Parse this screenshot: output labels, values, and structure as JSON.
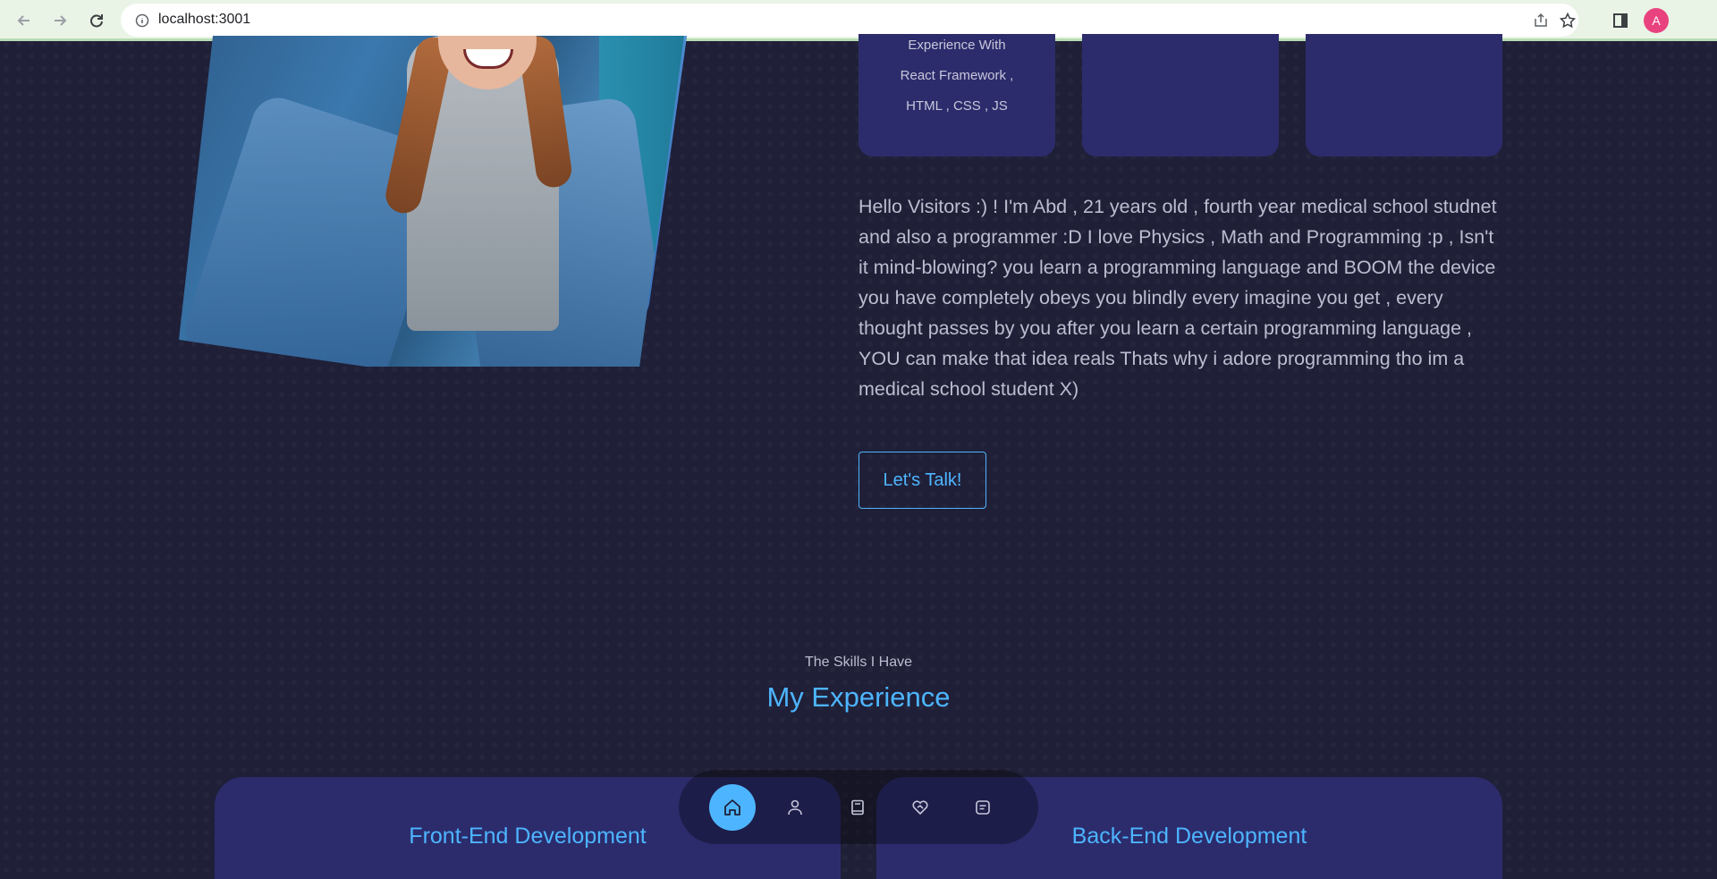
{
  "browser": {
    "url": "localhost:3001",
    "profile_initial": "A"
  },
  "about": {
    "cards": [
      {
        "lines": [
          "Experience With",
          "React Framework ,",
          "HTML , CSS , JS"
        ]
      },
      {
        "lines": []
      },
      {
        "lines": []
      }
    ],
    "paragraph": "Hello Visitors :) ! I'm Abd , 21 years old , fourth year medical school studnet and also a programmer :D I love Physics , Math and Programming :p , Isn't it mind-blowing? you learn a programming language and BOOM the device you have completely obeys you blindly every imagine you get , every thought passes by you after you learn a certain programming language , YOU can make that idea reals Thats why i adore programming tho im a medical school student X)",
    "cta_label": "Let's Talk!"
  },
  "experience": {
    "subtitle": "The Skills I Have",
    "title": "My Experience",
    "cards": [
      {
        "title": "Front-End Development"
      },
      {
        "title": "Back-End Development"
      }
    ]
  },
  "nav": {
    "items": [
      {
        "icon": "home-icon",
        "active": true
      },
      {
        "icon": "user-icon",
        "active": false
      },
      {
        "icon": "book-icon",
        "active": false
      },
      {
        "icon": "heart-handshake-icon",
        "active": false
      },
      {
        "icon": "message-icon",
        "active": false
      }
    ]
  },
  "colors": {
    "accent": "#4db5ff",
    "background": "#1f1f38",
    "card": "#2c2c6c",
    "text": "#bdbdd0"
  }
}
